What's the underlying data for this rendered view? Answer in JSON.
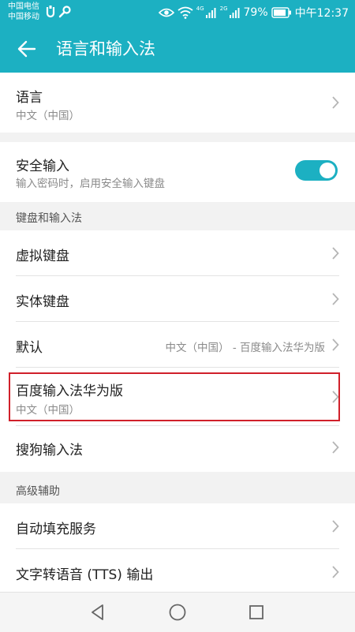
{
  "status_bar": {
    "carrier_1": "中国电信",
    "carrier_2": "中国移动",
    "net_1": "4G",
    "net_2": "2G",
    "battery": "79%",
    "time": "中午12:37",
    "icons": [
      "usb-icon",
      "wrench-icon",
      "eye-icon",
      "wifi-icon",
      "signal-icon",
      "battery-icon"
    ]
  },
  "app_bar": {
    "title": "语言和输入法"
  },
  "language": {
    "title": "语言",
    "value": "中文（中国）"
  },
  "secure_input": {
    "title": "安全输入",
    "subtitle": "输入密码时，启用安全输入键盘",
    "enabled": true
  },
  "keyboard_section": {
    "header": "键盘和输入法",
    "virtual_keyboard": "虚拟键盘",
    "physical_keyboard": "实体键盘",
    "default_label": "默认",
    "default_value": "中文（中国） - 百度输入法华为版",
    "baidu_title": "百度输入法华为版",
    "baidu_subtitle": "中文（中国）",
    "sogou": "搜狗输入法"
  },
  "advanced_section": {
    "header": "高级辅助",
    "autofill": "自动填充服务",
    "tts": "文字转语音 (TTS) 输出"
  },
  "colors": {
    "accent": "#1cb0c2",
    "highlight": "#d0202a"
  }
}
